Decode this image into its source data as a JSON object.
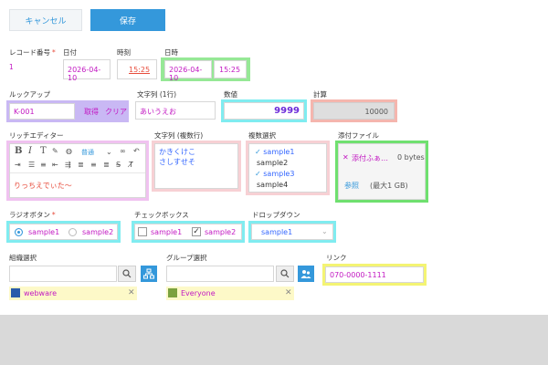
{
  "toolbar": {
    "cancel_label": "キャンセル",
    "save_label": "保存"
  },
  "record_no": {
    "label": "レコード番号",
    "required_mark": "*",
    "value": "1"
  },
  "date": {
    "label": "日付",
    "value": "2026-04-10"
  },
  "time": {
    "label": "時刻",
    "value": "15:25"
  },
  "datetime": {
    "label": "日時",
    "date_value": "2026-04-10",
    "time_value": "15:25"
  },
  "lookup": {
    "label": "ルックアップ",
    "value": "K-001",
    "fetch_label": "取得",
    "clear_label": "クリア"
  },
  "text_single": {
    "label": "文字列 (1行)",
    "value": "あいうえお"
  },
  "number": {
    "label": "数値",
    "value": "9999"
  },
  "calc": {
    "label": "計算",
    "value": "10000"
  },
  "rich": {
    "label": "リッチエディター",
    "font_size_option": "普通",
    "value": "りっちえでぃた～"
  },
  "text_multi": {
    "label": "文字列 (複数行)",
    "line1": "かきくけこ",
    "line2": "さしすせそ"
  },
  "multi_select": {
    "label": "複数選択",
    "options": [
      {
        "label": "sample1",
        "checked": true
      },
      {
        "label": "sample2",
        "checked": false
      },
      {
        "label": "sample3",
        "checked": true
      },
      {
        "label": "sample4",
        "checked": false
      }
    ]
  },
  "attachment": {
    "label": "添付ファイル",
    "file_name": "添付ふぁ…",
    "file_size": "0 bytes",
    "browse_label": "参照",
    "max_label": "(最大1 GB)"
  },
  "radio": {
    "label": "ラジオボタン",
    "required_mark": "*",
    "options": [
      "sample1",
      "sample2"
    ],
    "selected": "sample1"
  },
  "checkbox": {
    "label": "チェックボックス",
    "options": [
      "sample1",
      "sample2"
    ],
    "checked": [
      "sample2"
    ]
  },
  "dropdown": {
    "label": "ドロップダウン",
    "value": "sample1"
  },
  "org": {
    "label": "組織選択",
    "selected": "webware"
  },
  "group": {
    "label": "グループ選択",
    "selected": "Everyone"
  },
  "link": {
    "label": "リンク",
    "value": "070-0000-1111"
  },
  "colors": {
    "accent": "#3498db",
    "value_text": "#c218c2",
    "required": "#e74c3c"
  }
}
